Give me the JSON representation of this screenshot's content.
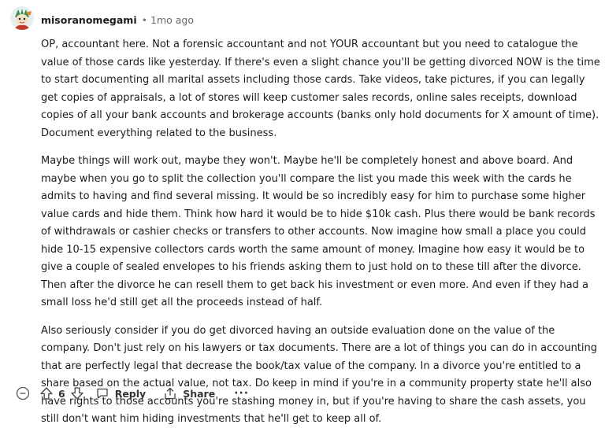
{
  "comment": {
    "username": "misoranomegami",
    "separator": "•",
    "timestamp": "1mo ago",
    "paragraphs": [
      "OP, accountant here. Not a forensic accountant and not YOUR accountant but you need to catalogue the value of those cards like yesterday. If there's even a slight chance you'll be getting divorced NOW is the time to start documenting all marital assets including those cards. Take videos, take pictures, if you can legally get copies of appraisals, a lot of stores will keep customer sales records, online sales receipts, download copies of all your bank accounts and brokerage accounts (banks only hold documents for X amount of time). Document everything related to the business.",
      "Maybe things will work out, maybe they won't. Maybe he'll be completely honest and above board. And maybe when you go to split the collection you'll compare the list you made this week with the cards he admits to having and find several missing. It would be so incredibly easy for him to purchase some higher value cards and hide them. Think how hard it would be to hide $10k cash. Plus there would be bank records of withdrawals or cashier checks or transfers to other accounts. Now imagine how small a place you could hide 10-15 expensive collectors cards worth the same amount of money. Imagine how easy it would be to give a couple of sealed envelopes to his friends asking them to just hold on to these till after the divorce. Then after the divorce he can resell them to get back his investment or even more. And even if they had a small loss he'd still get all the proceeds instead of half.",
      "Also seriously consider if you do get divorced having an outside evaluation done on the value of the company. Don't just rely on his lawyers or tax documents. There are a lot of things you can do in accounting that are perfectly legal that decrease the book/tax value of the company. In a divorce you're entitled to a share based on the actual value, not tax. Do keep in mind if you're in a community property state he'll also have rights to those accounts you're stashing money in, but if you're having to share the cash assets, you still don't want him hiding investments that he'll get to keep all of."
    ]
  },
  "actions": {
    "collapse_icon": "collapse-icon",
    "upvote_icon": "upvote-arrow-icon",
    "vote_count": "6",
    "downvote_icon": "downvote-arrow-icon",
    "reply_label": "Reply",
    "reply_icon": "comment-bubble-icon",
    "share_label": "Share",
    "share_icon": "share-icon",
    "more_label": "···"
  }
}
